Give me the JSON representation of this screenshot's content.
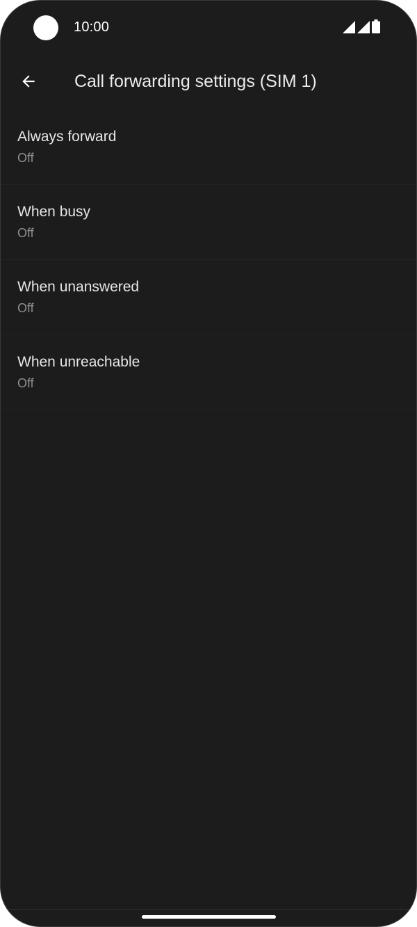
{
  "status_bar": {
    "time": "10:00",
    "icons": [
      "camera-cutout",
      "signal-sim1-icon",
      "signal-sim2-icon",
      "battery-icon"
    ]
  },
  "app_bar": {
    "back_icon": "arrow-left-icon",
    "title": "Call forwarding settings (SIM 1)"
  },
  "forwarding_options": [
    {
      "title": "Always forward",
      "summary": "Off"
    },
    {
      "title": "When busy",
      "summary": "Off"
    },
    {
      "title": "When unanswered",
      "summary": "Off"
    },
    {
      "title": "When unreachable",
      "summary": "Off"
    }
  ],
  "colors": {
    "background": "#1c1c1c",
    "title_text": "#e6e6e6",
    "summary_text": "#8e8e8e"
  }
}
